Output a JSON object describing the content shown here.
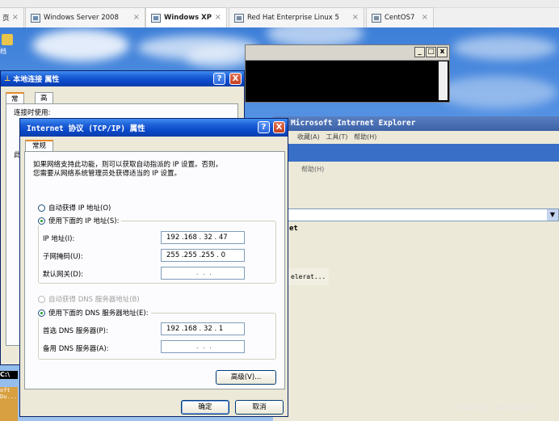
{
  "tabs": [
    {
      "label": "页",
      "active": false
    },
    {
      "label": "Windows Server 2008",
      "active": false
    },
    {
      "label": "Windows XP",
      "active": true
    },
    {
      "label": "Red Hat Enterprise Linux 5",
      "active": false
    },
    {
      "label": "CentOS7",
      "active": false
    }
  ],
  "desktop": {
    "icon_label": "档",
    "left_fragment": "C:\\",
    "left_text_1": "oft",
    "left_text_2": "Du..."
  },
  "lan_window": {
    "title": "本地连接 属性",
    "tab_general": "常规",
    "tab_advanced": "高级",
    "connect_using_label": "连接时使用:",
    "side_char": "此"
  },
  "cmd_window": {
    "min": "_",
    "max": "□",
    "close": "x"
  },
  "ie_window": {
    "title": "Microsoft Internet Explorer",
    "menu": [
      "收藏(A)",
      "工具(T)",
      "帮助(H)"
    ],
    "menu2": "帮助(H)",
    "fragment_1": "et",
    "fragment_2": "elerat..."
  },
  "dialog": {
    "title": "Internet 协议 (TCP/IP) 属性",
    "help_btn": "?",
    "close_btn": "X",
    "tab": "常规",
    "description_line1": "如果网络支持此功能，则可以获取自动指派的 IP 设置。否则，",
    "description_line2": "您需要从网络系统管理员处获得适当的 IP 设置。",
    "auto_ip_label": "自动获得 IP 地址(O)",
    "use_ip_label": "使用下面的 IP 地址(S):",
    "ip_label": "IP 地址(I):",
    "ip_value": "192 .168 . 32 . 47",
    "mask_label": "子网掩码(U):",
    "mask_value": "255 .255 .255 . 0",
    "gateway_label": "默认网关(D):",
    "gateway_value": " .  .  .",
    "auto_dns_label": "自动获得 DNS 服务器地址(B)",
    "use_dns_label": "使用下面的 DNS 服务器地址(E):",
    "preferred_dns_label": "首选 DNS 服务器(P):",
    "preferred_dns_value": "192 .168 . 32 . 1",
    "alternate_dns_label": "备用 DNS 服务器(A):",
    "alternate_dns_value": " .  .  .",
    "advanced_button": "高级(V)...",
    "ok_button": "确定",
    "cancel_button": "取消"
  },
  "watermark": "CSDN @ , BeYourself"
}
